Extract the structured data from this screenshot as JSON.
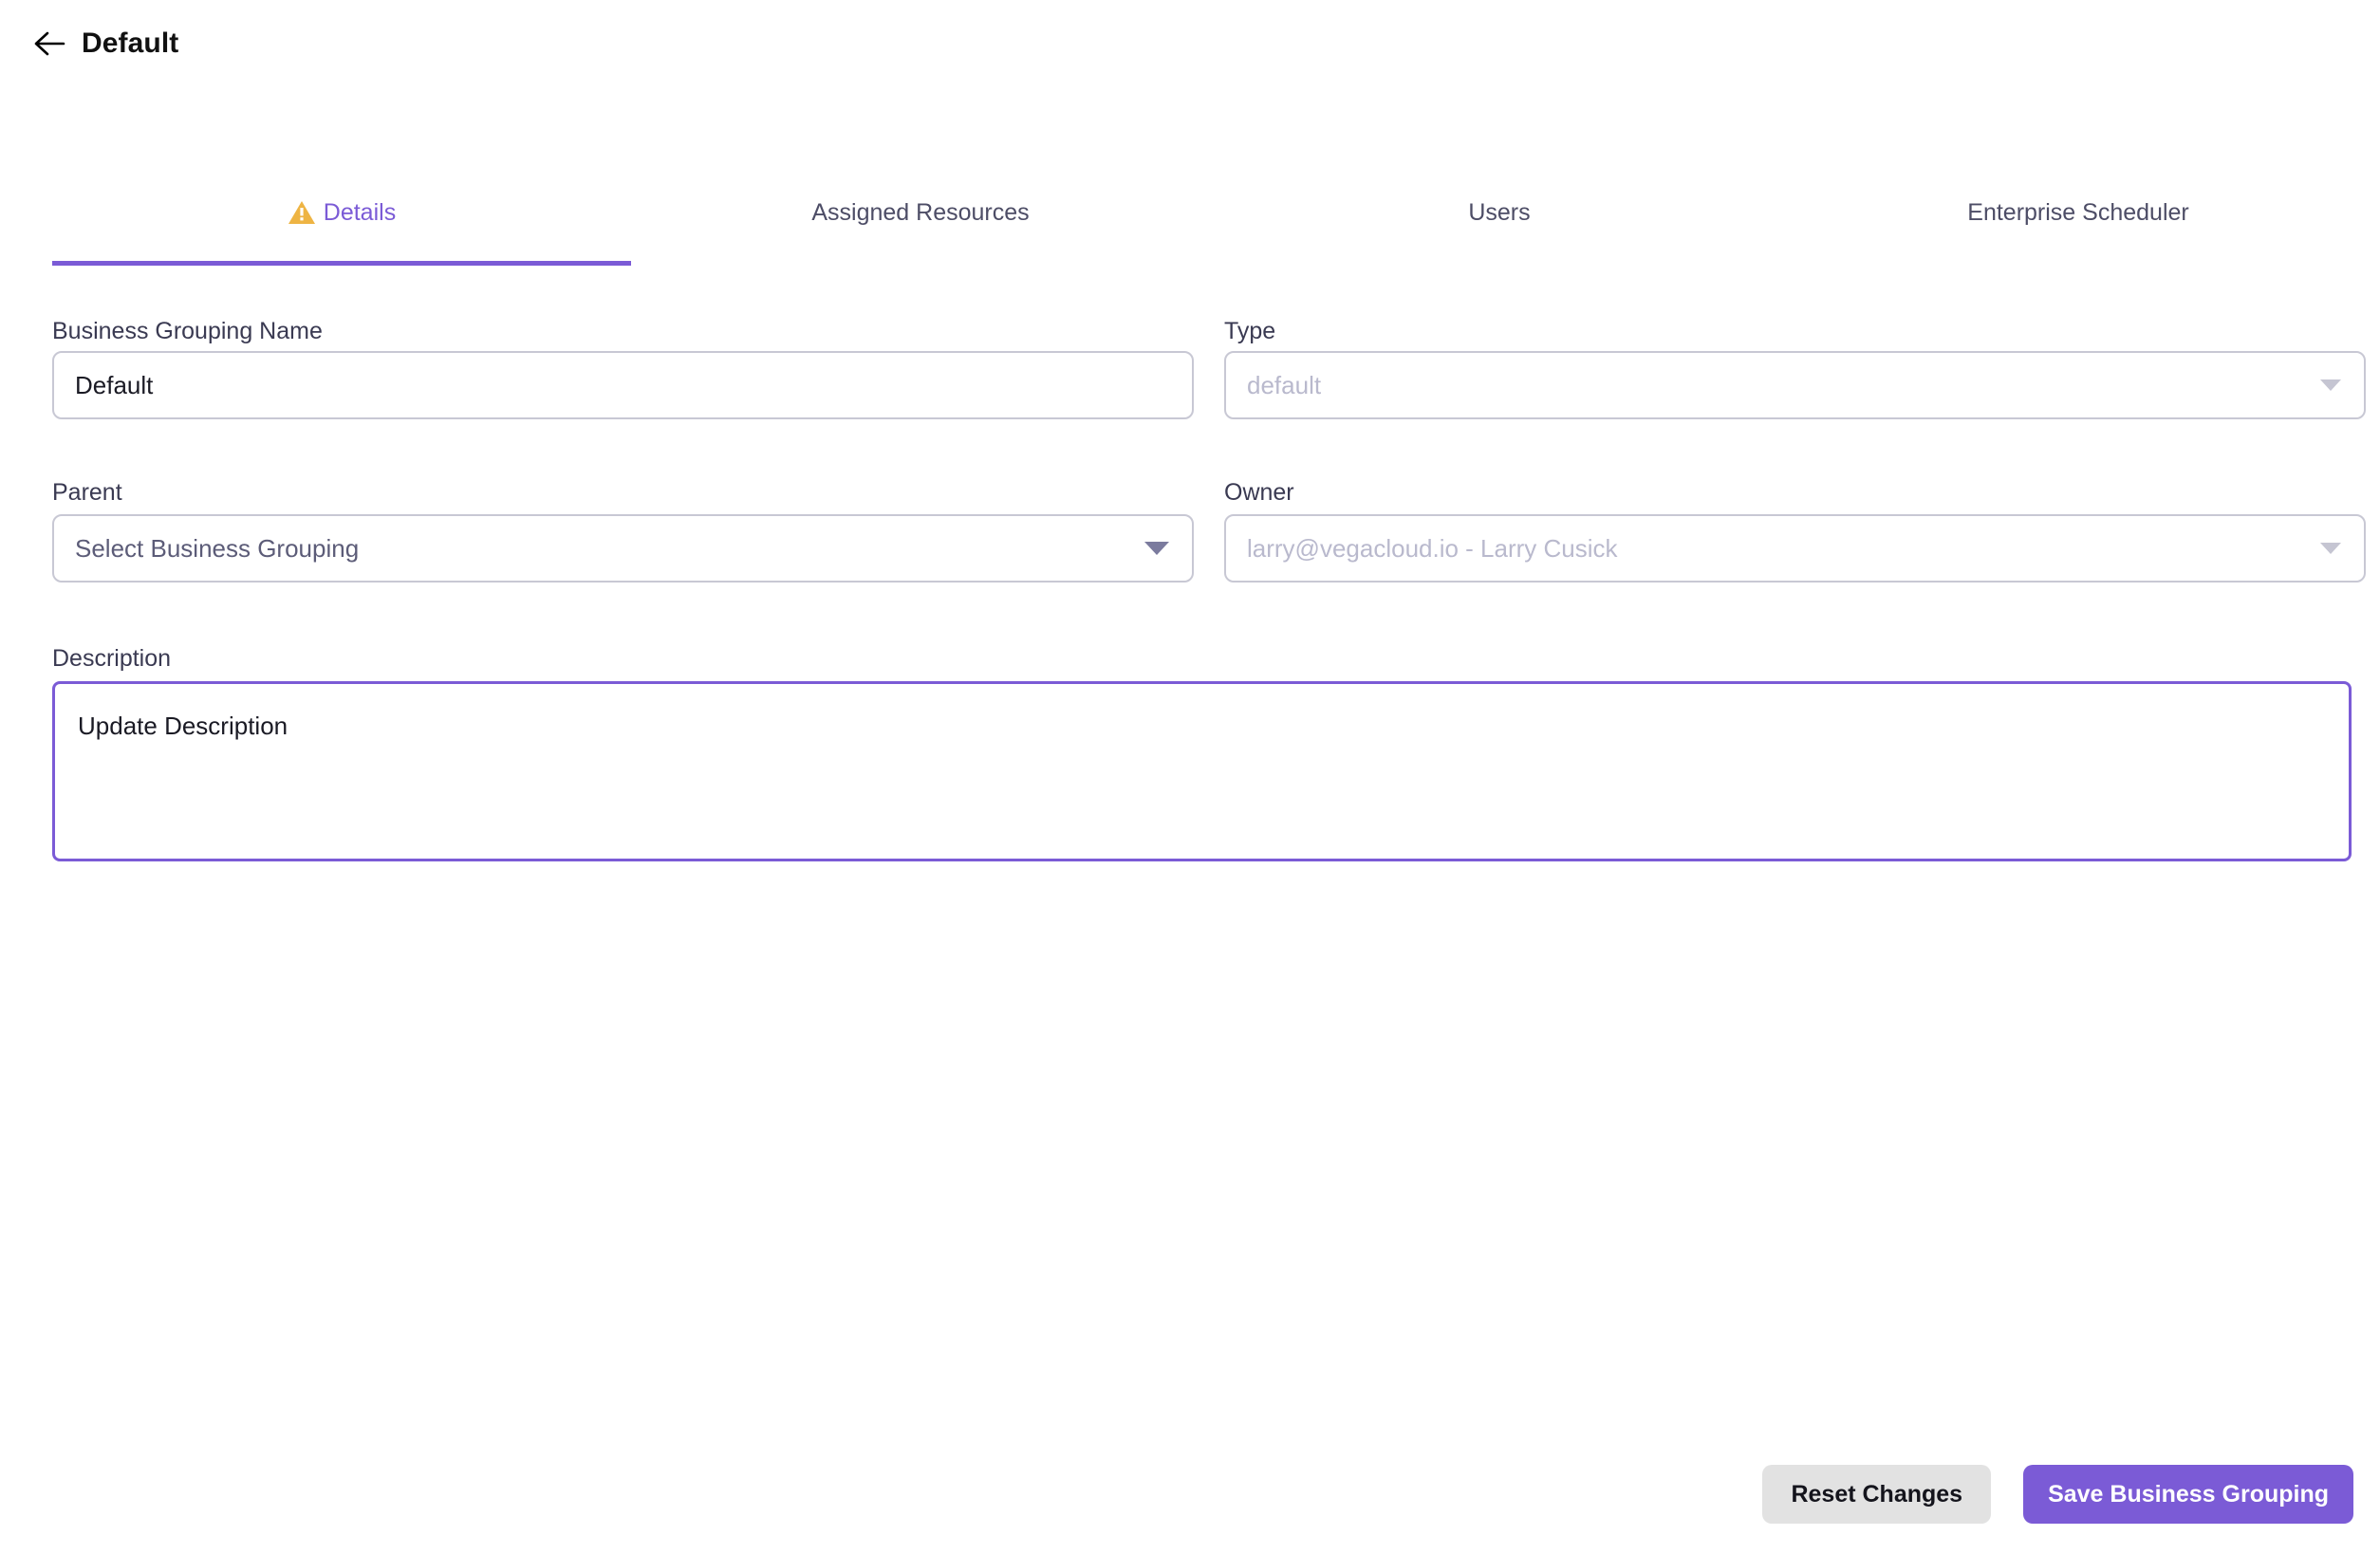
{
  "header": {
    "back_icon": "arrow-left-icon",
    "title": "Default"
  },
  "tabs": [
    {
      "id": "details",
      "label": "Details",
      "active": true,
      "icon": "warning-triangle-icon"
    },
    {
      "id": "assigned-resources",
      "label": "Assigned Resources",
      "active": false,
      "icon": ""
    },
    {
      "id": "users",
      "label": "Users",
      "active": false,
      "icon": ""
    },
    {
      "id": "enterprise-scheduler",
      "label": "Enterprise Scheduler",
      "active": false,
      "icon": ""
    }
  ],
  "form": {
    "business_grouping_name": {
      "label": "Business Grouping Name",
      "value": "Default",
      "placeholder": ""
    },
    "type": {
      "label": "Type",
      "value": "",
      "placeholder": "default",
      "disabled": true,
      "caret_icon": "chevron-down-icon"
    },
    "parent": {
      "label": "Parent",
      "value": "",
      "placeholder": "Select Business Grouping",
      "caret_icon": "chevron-down-icon"
    },
    "owner": {
      "label": "Owner",
      "value": "",
      "placeholder": "larry@vegacloud.io - Larry Cusick",
      "disabled": true,
      "caret_icon": "chevron-down-icon"
    },
    "description": {
      "label": "Description",
      "value": "Update Description",
      "focused": true
    }
  },
  "footer": {
    "reset_label": "Reset Changes",
    "save_label": "Save Business Grouping"
  },
  "colors": {
    "accent_purple": "#7b5bd6",
    "warning_amber": "#eeb443",
    "label_slate": "#3a3a52",
    "border_grey": "#c8c8d4",
    "reset_button_bg": "#e2e2e2"
  }
}
